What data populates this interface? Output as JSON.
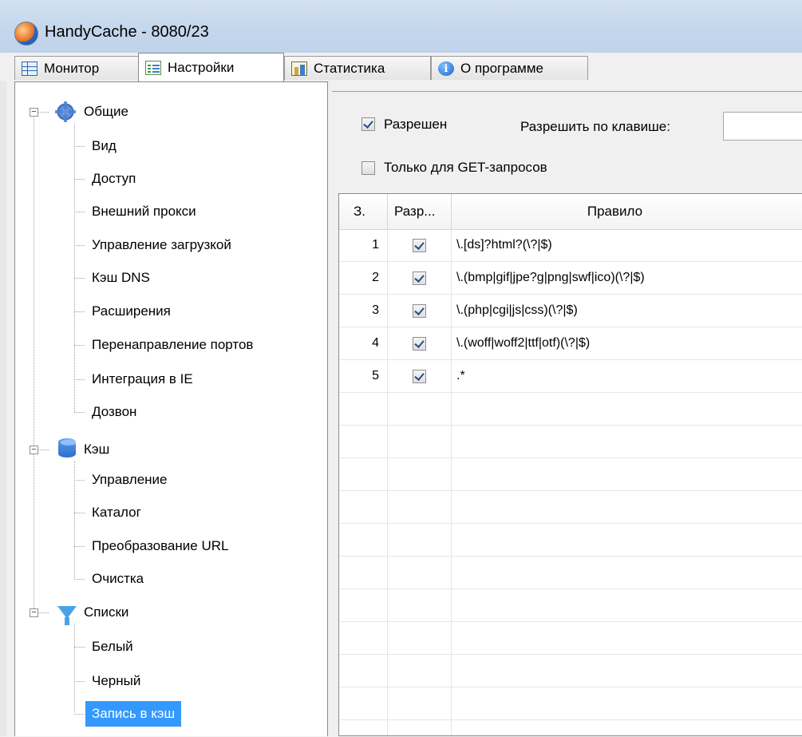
{
  "window": {
    "title": "HandyCache - 8080/23"
  },
  "tabs": [
    {
      "label": "Монитор",
      "icon": "monitor-icon"
    },
    {
      "label": "Настройки",
      "icon": "settings-icon",
      "active": true
    },
    {
      "label": "Статистика",
      "icon": "statistics-icon"
    },
    {
      "label": "О программе",
      "icon": "info-icon"
    }
  ],
  "tree": {
    "groups": [
      {
        "label": "Общие",
        "icon": "gear-icon",
        "items": [
          "Вид",
          "Доступ",
          "Внешний прокси",
          "Управление загрузкой",
          "Кэш DNS",
          "Расширения",
          "Перенаправление портов",
          "Интеграция в IE",
          "Дозвон"
        ]
      },
      {
        "label": "Кэш",
        "icon": "database-icon",
        "items": [
          "Управление",
          "Каталог",
          "Преобразование URL",
          "Очистка"
        ]
      },
      {
        "label": "Списки",
        "icon": "filter-icon",
        "items": [
          "Белый",
          "Черный",
          "Запись в кэш"
        ]
      }
    ],
    "selected": "Запись в кэш"
  },
  "options": {
    "enabled_label": "Разрешен",
    "enabled": true,
    "hotkey_label": "Разрешить по клавише:",
    "hotkey_value": "",
    "get_only_label": "Только для GET-запросов",
    "get_only": false
  },
  "rules_table": {
    "columns": [
      "З.",
      "Разр...",
      "Правило"
    ],
    "rows": [
      {
        "n": "1",
        "allowed": true,
        "rule": "\\.[ds]?html?(\\?|$)"
      },
      {
        "n": "2",
        "allowed": true,
        "rule": "\\.(bmp|gif|jpe?g|png|swf|ico)(\\?|$)"
      },
      {
        "n": "3",
        "allowed": true,
        "rule": "\\.(php|cgi|js|css)(\\?|$)"
      },
      {
        "n": "4",
        "allowed": true,
        "rule": "\\.(woff|woff2|ttf|otf)(\\?|$)"
      },
      {
        "n": "5",
        "allowed": true,
        "rule": ".*"
      }
    ]
  }
}
